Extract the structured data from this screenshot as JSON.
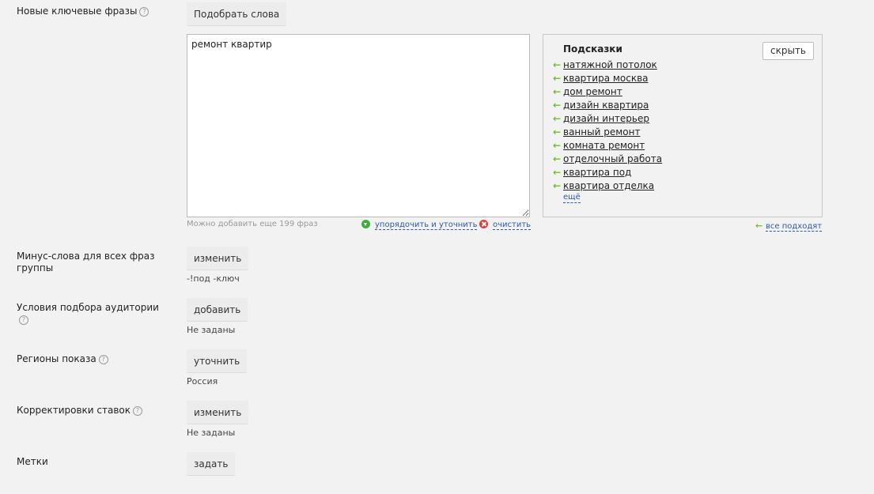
{
  "keywords": {
    "label": "Новые ключевые фразы",
    "help": "?",
    "pick_button": "Подобрать слова",
    "textarea_value": "ремонт квартир",
    "remaining_note": "Можно добавить еще 199 фраз",
    "sort_action": "упорядочить и уточнить",
    "clear_action": "очистить"
  },
  "suggestions": {
    "title": "Подсказки",
    "hide_button": "скрыть",
    "arrow": "←",
    "items": [
      "натяжной потолок",
      "квартира москва",
      "дом ремонт",
      "дизайн квартира",
      "дизайн интерьер",
      "ванный ремонт",
      "комната ремонт",
      "отделочный работа",
      "квартира под",
      "квартира отделка"
    ],
    "more": "ещё",
    "all_fit": "все подходят"
  },
  "minus_words": {
    "label": "Минус-слова для всех фраз группы",
    "button": "изменить",
    "value": "-!под -ключ"
  },
  "audience": {
    "label": "Условия подбора аудитории",
    "help": "?",
    "button": "добавить",
    "value": "Не заданы"
  },
  "regions": {
    "label": "Регионы показа",
    "help": "?",
    "button": "уточнить",
    "value": "Россия"
  },
  "bid_adjustments": {
    "label": "Корректировки ставок",
    "help": "?",
    "button": "изменить",
    "value": "Не заданы"
  },
  "tags": {
    "label": "Метки",
    "button": "задать"
  }
}
